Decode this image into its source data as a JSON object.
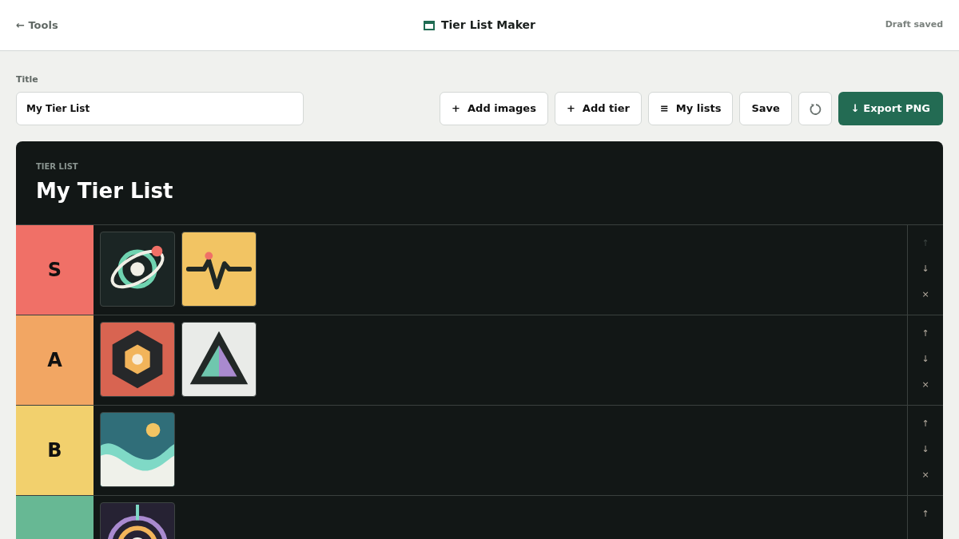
{
  "topbar": {
    "back_link": "← Tools",
    "title": "Tier List Maker",
    "status": "Draft saved"
  },
  "title_field": {
    "label": "Title",
    "value": "My Tier List"
  },
  "toolbar": [
    {
      "kind": "text",
      "label": "+  Add images"
    },
    {
      "kind": "text",
      "label": "+  Add tier"
    },
    {
      "kind": "text",
      "label": "≡  My lists"
    },
    {
      "kind": "text",
      "label": "Save"
    },
    {
      "kind": "undo"
    },
    {
      "kind": "primary",
      "label": "↓ Export PNG"
    }
  ],
  "board": {
    "eyebrow": "TIER LIST",
    "title": "My Tier List",
    "tiers": [
      {
        "label": "S",
        "color": "#f07067",
        "items": [
          {
            "kind": "orbit"
          },
          {
            "kind": "pulse"
          }
        ],
        "controls": [
          {
            "label": "↑",
            "disabled": true
          },
          {
            "label": "↓",
            "disabled": false
          },
          {
            "label": "×",
            "disabled": false
          }
        ]
      },
      {
        "label": "A",
        "color": "#f2a663",
        "items": [
          {
            "kind": "hexagon"
          },
          {
            "kind": "triangle"
          }
        ],
        "controls": [
          {
            "label": "↑",
            "disabled": false
          },
          {
            "label": "↓",
            "disabled": false
          },
          {
            "label": "×",
            "disabled": false
          }
        ]
      },
      {
        "label": "B",
        "color": "#f2d06d",
        "items": [
          {
            "kind": "landscape"
          }
        ],
        "controls": [
          {
            "label": "↑",
            "disabled": false
          },
          {
            "label": "↓",
            "disabled": false
          },
          {
            "label": "×",
            "disabled": false
          }
        ]
      },
      {
        "color": "#67b894",
        "items": [
          {
            "kind": "target"
          }
        ],
        "controls": [
          {
            "label": "↑",
            "disabled": false
          }
        ]
      }
    ]
  }
}
